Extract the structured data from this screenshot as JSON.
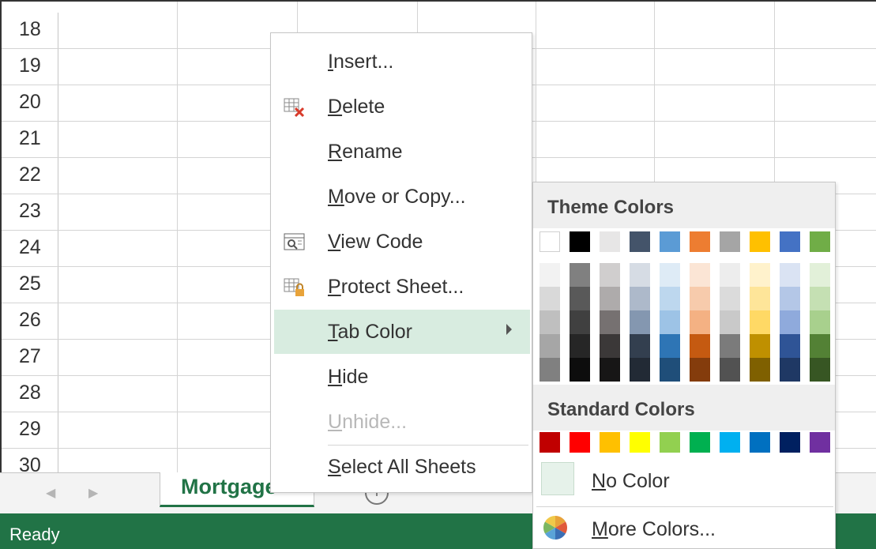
{
  "sheet": {
    "row_numbers": [
      "18",
      "19",
      "20",
      "21",
      "22",
      "23",
      "24",
      "25",
      "26",
      "27",
      "28",
      "29",
      "30"
    ]
  },
  "tabs": {
    "sheet_tab_label": "Mortgage",
    "new_sheet_symbol": "+",
    "prev_arrow": "◀",
    "next_arrow": "▶"
  },
  "status": {
    "text": "Ready"
  },
  "context_menu": {
    "items": [
      {
        "underline": "I",
        "rest": "nsert...",
        "icon": "",
        "state": "normal"
      },
      {
        "underline": "D",
        "rest": "elete",
        "icon": "delete-sheet-icon",
        "state": "normal"
      },
      {
        "underline": "R",
        "rest": "ename",
        "icon": "",
        "state": "normal"
      },
      {
        "underline": "M",
        "rest": "ove or Copy...",
        "icon": "",
        "state": "normal"
      },
      {
        "underline": "V",
        "rest": "iew Code",
        "icon": "view-code-icon",
        "state": "normal"
      },
      {
        "underline": "P",
        "rest": "rotect Sheet...",
        "icon": "protect-sheet-icon",
        "state": "normal"
      },
      {
        "underline": "T",
        "rest": "ab Color",
        "icon": "",
        "state": "hover",
        "submenu": true
      },
      {
        "underline": "H",
        "rest": "ide",
        "icon": "",
        "state": "normal"
      },
      {
        "underline": "U",
        "rest": "nhide...",
        "icon": "",
        "state": "disabled"
      },
      {
        "underline": "S",
        "rest": "elect All Sheets",
        "icon": "",
        "state": "normal"
      }
    ]
  },
  "palette": {
    "theme_title": "Theme Colors",
    "standard_title": "Standard Colors",
    "theme_colors": [
      {
        "base": "#ffffff",
        "shades": [
          "#f2f2f2",
          "#d9d9d9",
          "#bfbfbf",
          "#a6a6a6",
          "#808080"
        ]
      },
      {
        "base": "#000000",
        "shades": [
          "#808080",
          "#595959",
          "#404040",
          "#262626",
          "#0d0d0d"
        ]
      },
      {
        "base": "#e7e6e6",
        "shades": [
          "#d0cece",
          "#aeabab",
          "#767171",
          "#3b3838",
          "#171616"
        ]
      },
      {
        "base": "#44546a",
        "shades": [
          "#d6dce4",
          "#adb9ca",
          "#8497b0",
          "#333f4f",
          "#222a35"
        ]
      },
      {
        "base": "#5b9bd5",
        "shades": [
          "#deebf6",
          "#bdd7ee",
          "#9dc3e6",
          "#2e75b5",
          "#1f4e79"
        ]
      },
      {
        "base": "#ed7d31",
        "shades": [
          "#fbe5d5",
          "#f7cbac",
          "#f4b183",
          "#c55a11",
          "#843c0c"
        ]
      },
      {
        "base": "#a5a5a5",
        "shades": [
          "#ededed",
          "#dbdbdb",
          "#c9c9c9",
          "#7b7b7b",
          "#525252"
        ]
      },
      {
        "base": "#ffc000",
        "shades": [
          "#fff2cc",
          "#fee599",
          "#ffd965",
          "#bf9000",
          "#7f6000"
        ]
      },
      {
        "base": "#4472c4",
        "shades": [
          "#dae3f3",
          "#b4c7e7",
          "#8faadc",
          "#2f5496",
          "#1f3864"
        ]
      },
      {
        "base": "#70ad47",
        "shades": [
          "#e2f0d9",
          "#c5e0b3",
          "#a8d08d",
          "#538135",
          "#375623"
        ]
      }
    ],
    "standard_colors": [
      "#c00000",
      "#ff0000",
      "#ffc000",
      "#ffff00",
      "#92d050",
      "#00b050",
      "#00b0f0",
      "#0070c0",
      "#002060",
      "#7030a0"
    ],
    "no_color": {
      "underline": "N",
      "rest": "o Color"
    },
    "more_colors": {
      "underline": "M",
      "rest": "ore Colors..."
    }
  }
}
